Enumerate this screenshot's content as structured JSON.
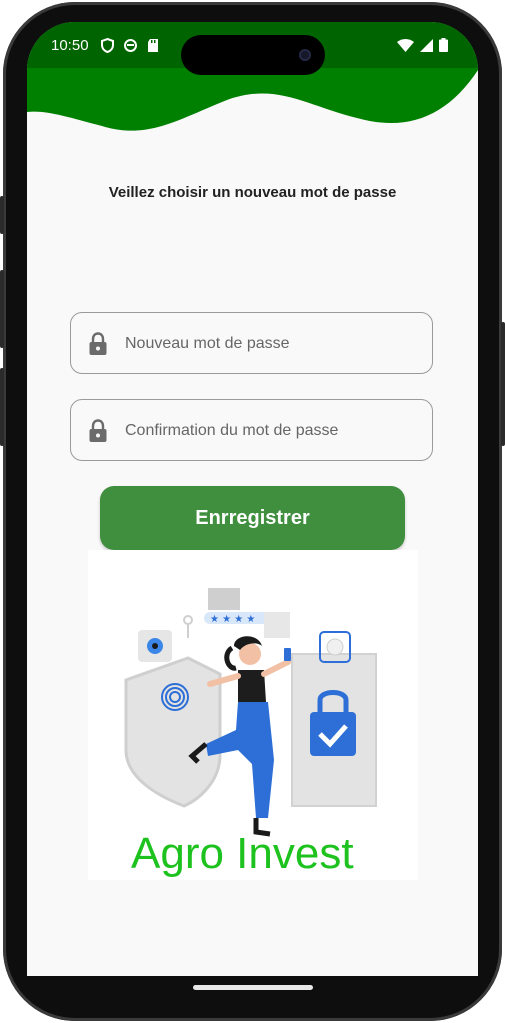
{
  "status_bar": {
    "time": "10:50"
  },
  "page": {
    "title": "Veillez choisir un nouveau mot de passe"
  },
  "form": {
    "new_password_placeholder": "Nouveau mot de passe",
    "confirm_password_placeholder": "Confirmation du mot de passe",
    "save_label": "Enrregistrer"
  },
  "illustration": {
    "brand_text": "Agro Invest"
  },
  "colors": {
    "header_green": "#008000",
    "button_green": "#3f8f3f",
    "brand_green": "#1ec21e",
    "background": "#f9f9f9"
  },
  "icons": [
    "shield-status-icon",
    "sync-status-icon",
    "sdcard-status-icon",
    "wifi-icon",
    "signal-icon",
    "battery-icon",
    "lock-icon"
  ]
}
